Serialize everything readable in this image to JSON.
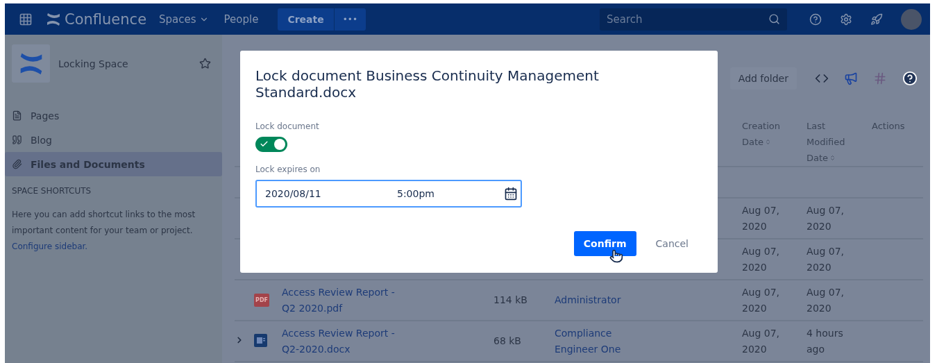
{
  "topbar": {
    "product": "Confluence",
    "nav": [
      {
        "label": "Spaces",
        "dropdown": true
      },
      {
        "label": "People",
        "dropdown": false
      }
    ],
    "create": "Create",
    "more": "•••",
    "search": {
      "placeholder": "Search"
    }
  },
  "sidebar": {
    "space_name": "Locking Space",
    "items": [
      {
        "label": "Pages",
        "selected": false
      },
      {
        "label": "Blog",
        "selected": false
      },
      {
        "label": "Files and Documents",
        "selected": true
      }
    ],
    "shortcuts_heading": "SPACE SHORTCUTS",
    "shortcuts_text": "Here you can add shortcut links to the most important content for your team or project.",
    "configure_link": "Configure sidebar."
  },
  "toolbar": {
    "add_folder": "Add folder"
  },
  "table": {
    "columns": [
      {
        "label": "Creation Date",
        "sortable": true
      },
      {
        "label": "Last Modified Date",
        "sortable": true
      },
      {
        "label": "Actions",
        "sortable": false
      }
    ],
    "rows": [
      {
        "created": "Aug 07, 2020",
        "modified": "Aug 07, 2020"
      },
      {
        "created": "Aug 07, 2020",
        "modified": "Aug 07, 2020"
      },
      {
        "expandable": false,
        "kind": "pdf",
        "badge": "PDF",
        "name": "Access Review Report - Q2 2020.pdf",
        "size": "114 kB",
        "creator": "Administrator",
        "created": "Aug 07, 2020",
        "modified": "Aug 07, 2020"
      },
      {
        "expandable": true,
        "kind": "word",
        "name": "Access Review Report - Q2-2020.docx",
        "size": "68 kB",
        "creator": "Compliance Engineer One",
        "created": "Aug 07, 2020",
        "modified": "4 hours ago"
      }
    ]
  },
  "modal": {
    "title": "Lock document Business Continuity Management Standard.docx",
    "lock_label": "Lock document",
    "lock_on": true,
    "expires_label": "Lock expires on",
    "date": "2020/08/11",
    "time": "5:00pm",
    "confirm": "Confirm",
    "cancel": "Cancel"
  }
}
